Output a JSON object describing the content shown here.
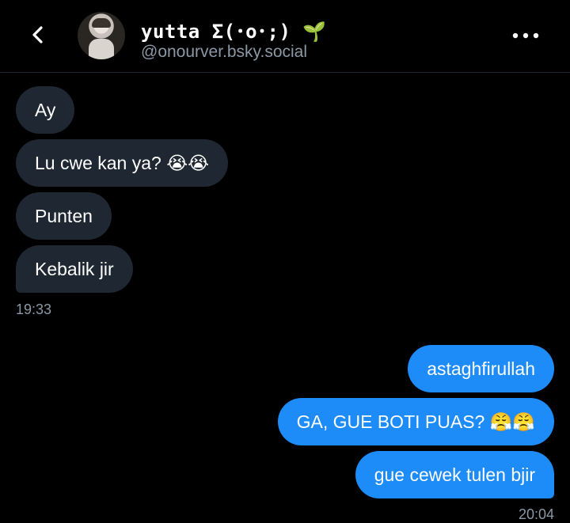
{
  "header": {
    "name": "yutta Σ(･o･;) 🌱",
    "handle": "@onourver.bsky.social"
  },
  "messages": {
    "incoming": [
      {
        "text": "Ay"
      },
      {
        "text": "Lu cwe kan ya? 😭😭"
      },
      {
        "text": "Punten"
      },
      {
        "text": "Kebalik jir"
      }
    ],
    "incoming_time": "19:33",
    "outgoing": [
      {
        "text": "astaghfirullah"
      },
      {
        "text": "GA, GUE BOTI PUAS? 😤😤"
      },
      {
        "text": "gue cewek tulen bjir"
      }
    ],
    "outgoing_time": "20:04"
  },
  "colors": {
    "background": "#000000",
    "incoming_bubble": "#1e2732",
    "outgoing_bubble": "#1d8cf8",
    "muted_text": "#8b98a5"
  },
  "icons": {
    "back": "chevron-left-icon",
    "more": "more-horizontal-icon"
  }
}
